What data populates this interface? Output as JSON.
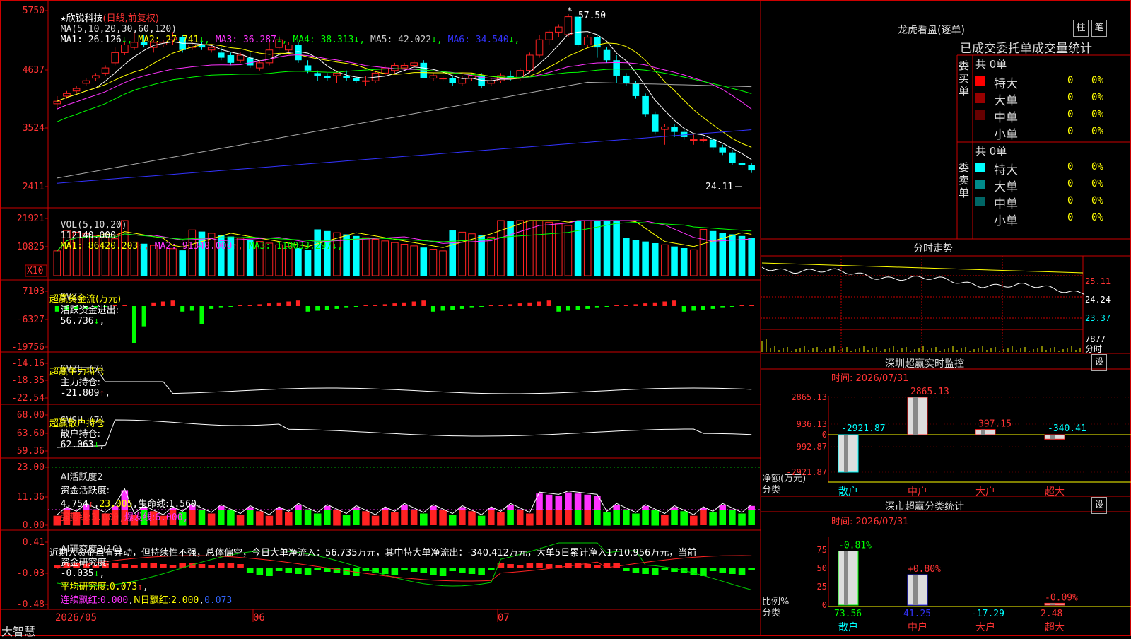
{
  "app": {
    "brand": "大智慧"
  },
  "stock": {
    "star": "★",
    "name": "欣锐科技",
    "mode": "(日线,前复权)"
  },
  "colors": {
    "up": "#ff2222",
    "down": "#00ffff",
    "ma1": "#ffffff",
    "ma2": "#ffff00",
    "ma3": "#ff33ff",
    "ma4": "#00ff00",
    "ma5": "#aaaaaa",
    "ma6": "#3333ff",
    "grid": "#8b0000",
    "frame": "#cc0000"
  },
  "price_panel": {
    "ma_label": "MA(5,10,20,30,60,120)",
    "ma": [
      {
        "name": "MA1:",
        "value": "26.126",
        "arrow": "↓",
        "color": "#ffffff"
      },
      {
        "name": "MA2:",
        "value": "27.741",
        "arrow": "↓",
        "color": "#ffff00"
      },
      {
        "name": "MA3:",
        "value": "36.287",
        "arrow": "↓",
        "color": "#ff33ff"
      },
      {
        "name": "MA4:",
        "value": "38.313",
        "arrow": "↓",
        "color": "#00ff00"
      },
      {
        "name": "MA5:",
        "value": "42.022",
        "arrow": "↓",
        "color": "#cccccc"
      },
      {
        "name": "MA6:",
        "value": "34.540",
        "arrow": "↓",
        "color": "#3333ff"
      }
    ],
    "yticks": [
      "5750",
      "4637",
      "3524",
      "2411"
    ],
    "high_label": "57.50",
    "low_label": "24.11"
  },
  "vol_panel": {
    "label": "VOL(5,10,20)",
    "value": "112140.000",
    "arrow": "↑",
    "items": [
      {
        "name": "MA1:",
        "value": "86420.203",
        "arrow": "↑",
        "color": "#ffff00"
      },
      {
        "name": "MA2:",
        "value": "91340.000",
        "arrow": "↑",
        "color": "#ff33ff"
      },
      {
        "name": "MA3:",
        "value": "110033.297",
        "arrow": "↓",
        "color": "#00ff00"
      }
    ],
    "yticks": [
      "21921",
      "10825"
    ],
    "unit": "X10"
  },
  "svzj_panel": {
    "label": "SVZJ",
    "name": "活跃资金进出:",
    "value": "56.736",
    "arrow": "↓",
    "sub": "超赢资金流(万元)",
    "yticks": [
      "7103",
      "-6327",
      "-19756"
    ]
  },
  "svzl_panel": {
    "label": "SVZL (7)",
    "name": "主力持仓:",
    "value": "-21.809",
    "arrow": "↑",
    "sub": "超赢主力持仓",
    "yticks": [
      "-14.16",
      "-18.35",
      "-22.54"
    ]
  },
  "svsh_panel": {
    "label": "SVSH (7)",
    "name": "散户持仓:",
    "value": "62.063",
    "arrow": "↓",
    "sub": "超赢散户持仓",
    "yticks": [
      "68.00",
      "63.60",
      "59.36"
    ]
  },
  "ai1_panel": {
    "label": "AI活跃度2",
    "name": "资金活跃度:",
    "value": "4.754",
    "arrow": "↑",
    "v2": "23.005",
    "life_name": "生命线:",
    "life": "1.560",
    "strong_name": "强势线:",
    "strong": "3.000",
    "burst_name": "爆发线:",
    "burst": "6.000",
    "yticks": [
      "23.00",
      "11.36",
      "0.00"
    ]
  },
  "ai2_panel": {
    "label": "AI研究度2(10)",
    "name": "资金研究度:",
    "value": "-0.035",
    "arrow": "↓",
    "avg_name": "平均研究度:",
    "avg": "0.073",
    "avg_arrow": "↑",
    "red_name": "连续飘红:",
    "red": "0.000",
    "nred_name": "N日飘红:",
    "nred": "2.000",
    "last": "0.073",
    "yticks": [
      "0.41",
      "-0.03",
      "-0.48"
    ],
    "comment": "近期大资金虽有异动，但持续性不强，总体偏空，今日大单净流入：56.735万元，其中特大单净流出：-340.412万元，大单5日累计净入1710.956万元，当前"
  },
  "date_axis": {
    "labels": [
      "2026/05",
      "06",
      "07"
    ]
  },
  "dragon": {
    "title": "龙虎看盘(逐单)",
    "btn1": "柱",
    "btn2": "笔",
    "header": "已成交委托单成交量统计",
    "buy": {
      "label": "委买单",
      "total": "共 0单",
      "rows": [
        {
          "name": "特大",
          "count": "0",
          "pct": "0%",
          "color": "#ff0000"
        },
        {
          "name": "大单",
          "count": "0",
          "pct": "0%",
          "color": "#990000"
        },
        {
          "name": "中单",
          "count": "0",
          "pct": "0%",
          "color": "#660000"
        },
        {
          "name": "小单",
          "count": "0",
          "pct": "0%",
          "color": ""
        }
      ]
    },
    "sell": {
      "label": "委卖单",
      "total": "共 0单",
      "rows": [
        {
          "name": "特大",
          "count": "0",
          "pct": "0%",
          "color": "#00ffff"
        },
        {
          "name": "大单",
          "count": "0",
          "pct": "0%",
          "color": "#008b8b"
        },
        {
          "name": "中单",
          "count": "0",
          "pct": "0%",
          "color": "#006666"
        },
        {
          "name": "小单",
          "count": "0",
          "pct": "0%",
          "color": ""
        }
      ]
    }
  },
  "intraday": {
    "title": "分时走势",
    "yticks": [
      "25.11",
      "24.24",
      "23.37",
      "7877"
    ],
    "unit": "分时"
  },
  "sz_monitor": {
    "title": "深圳超赢实时监控",
    "btn": "设",
    "time": "时间: 2026/07/31",
    "yticks": [
      "2865.13",
      "936.13",
      "0",
      "-992.87",
      "-2921.87"
    ],
    "ylabel1": "净额(万元)",
    "ylabel2": "分类",
    "categories": [
      "散户",
      "中户",
      "大户",
      "超大"
    ],
    "values": [
      "-2921.87",
      "2865.13",
      "397.15",
      "-340.41"
    ]
  },
  "sz_class": {
    "title": "深市超赢分类统计",
    "btn": "设",
    "time": "时间: 2026/07/31",
    "yticks": [
      "75",
      "50",
      "25",
      "0"
    ],
    "ylabel1": "比例%",
    "ylabel2": "分类",
    "categories": [
      "散户",
      "中户",
      "大户",
      "超大"
    ],
    "pcts": [
      "-0.81%",
      "+0.80%",
      "",
      "-0.09%"
    ],
    "values": [
      "73.56",
      "41.25",
      "-17.29",
      "2.48"
    ]
  },
  "chart_data": [
    {
      "type": "candlestick",
      "title": "欣锐科技 (日线,前复权)",
      "dates": [
        "2026/05",
        "06",
        "07"
      ],
      "ylim": [
        24.11,
        57.5
      ],
      "ohlc": [
        [
          40.0,
          41.5,
          39.0,
          40.5
        ],
        [
          41.5,
          42.5,
          41.0,
          42.0
        ],
        [
          42.5,
          43.5,
          42.0,
          43.0
        ],
        [
          44.0,
          45.0,
          43.5,
          44.5
        ],
        [
          45.0,
          46.0,
          44.5,
          45.5
        ],
        [
          46.0,
          47.5,
          45.5,
          47.0
        ],
        [
          48.0,
          51.0,
          47.5,
          50.0
        ],
        [
          50.0,
          52.0,
          49.5,
          51.5
        ],
        [
          51.0,
          54.0,
          50.5,
          52.0
        ],
        [
          52.0,
          53.5,
          51.0,
          51.5
        ],
        [
          51.0,
          52.5,
          50.0,
          52.0
        ],
        [
          51.5,
          52.5,
          51.0,
          52.0
        ],
        [
          52.5,
          54.0,
          51.5,
          53.0
        ],
        [
          53.0,
          53.5,
          50.0,
          50.5
        ],
        [
          51.0,
          52.0,
          50.5,
          51.5
        ],
        [
          51.5,
          52.0,
          50.5,
          51.0
        ],
        [
          50.5,
          51.5,
          50.0,
          51.0
        ],
        [
          50.0,
          51.0,
          48.5,
          49.0
        ],
        [
          49.5,
          50.0,
          47.5,
          48.0
        ],
        [
          48.5,
          50.0,
          48.0,
          49.5
        ],
        [
          49.0,
          50.0,
          47.0,
          47.5
        ],
        [
          47.0,
          48.5,
          46.5,
          48.0
        ],
        [
          48.0,
          52.0,
          47.5,
          50.5
        ],
        [
          51.0,
          53.5,
          50.5,
          52.5
        ],
        [
          50.5,
          52.0,
          50.0,
          51.5
        ],
        [
          51.5,
          52.0,
          48.0,
          48.5
        ],
        [
          47.5,
          48.5,
          46.0,
          46.5
        ],
        [
          46.0,
          46.5,
          44.5,
          45.5
        ],
        [
          45.5,
          46.0,
          44.5,
          45.0
        ],
        [
          45.5,
          46.5,
          44.0,
          46.0
        ],
        [
          45.5,
          46.5,
          44.5,
          45.0
        ],
        [
          45.0,
          45.5,
          44.0,
          44.5
        ],
        [
          44.5,
          45.5,
          43.5,
          44.5
        ],
        [
          44.5,
          46.5,
          44.0,
          46.0
        ],
        [
          46.0,
          47.5,
          45.5,
          47.0
        ],
        [
          46.5,
          48.0,
          46.0,
          47.5
        ],
        [
          47.0,
          48.0,
          46.5,
          47.5
        ],
        [
          47.5,
          48.5,
          47.0,
          48.0
        ],
        [
          48.0,
          48.5,
          45.5,
          45.0
        ],
        [
          45.0,
          46.0,
          44.5,
          45.5
        ],
        [
          45.0,
          45.5,
          44.5,
          45.0
        ],
        [
          45.0,
          45.5,
          43.5,
          44.0
        ],
        [
          44.0,
          45.5,
          43.5,
          45.0
        ],
        [
          45.0,
          46.0,
          44.5,
          45.5
        ],
        [
          45.5,
          46.0,
          43.0,
          43.5
        ],
        [
          44.0,
          45.0,
          43.5,
          44.5
        ],
        [
          44.5,
          46.0,
          44.0,
          45.5
        ],
        [
          45.5,
          46.5,
          44.5,
          45.0
        ],
        [
          45.0,
          47.0,
          44.5,
          46.5
        ],
        [
          46.5,
          50.0,
          46.0,
          49.5
        ],
        [
          49.5,
          53.5,
          49.0,
          52.5
        ],
        [
          52.5,
          54.5,
          51.5,
          54.0
        ],
        [
          54.0,
          55.5,
          53.0,
          55.0
        ],
        [
          53.5,
          57.5,
          53.0,
          57.0
        ],
        [
          57.0,
          57.0,
          51.0,
          51.5
        ],
        [
          51.5,
          53.5,
          51.0,
          53.0
        ],
        [
          53.0,
          53.5,
          49.0,
          51.0
        ],
        [
          50.5,
          51.0,
          48.0,
          48.5
        ],
        [
          48.5,
          49.5,
          44.0,
          45.5
        ],
        [
          45.5,
          46.0,
          43.5,
          44.0
        ],
        [
          44.0,
          44.5,
          41.0,
          41.5
        ],
        [
          41.5,
          42.0,
          37.5,
          38.0
        ],
        [
          38.0,
          38.5,
          34.0,
          34.5
        ],
        [
          35.0,
          36.0,
          32.0,
          35.5
        ],
        [
          35.5,
          36.0,
          33.5,
          34.5
        ],
        [
          34.5,
          35.0,
          33.0,
          33.5
        ],
        [
          33.0,
          34.0,
          32.0,
          33.0
        ],
        [
          33.0,
          33.5,
          32.5,
          33.0
        ],
        [
          33.0,
          33.5,
          31.0,
          31.5
        ],
        [
          31.5,
          32.0,
          30.0,
          30.5
        ],
        [
          30.5,
          31.0,
          28.0,
          28.5
        ],
        [
          28.5,
          29.0,
          27.5,
          28.0
        ],
        [
          28.0,
          28.5,
          26.5,
          27.0
        ]
      ]
    },
    {
      "type": "bar",
      "title": "VOL(5,10,20)",
      "ylim": [
        0,
        21921
      ]
    },
    {
      "type": "bar",
      "title": "SVZJ 活跃资金进出",
      "ylim": [
        -19756,
        7103
      ]
    },
    {
      "type": "line",
      "title": "SVZL (7) 主力持仓",
      "ylim": [
        -22.54,
        -14.16
      ]
    },
    {
      "type": "line",
      "title": "SVSH (7) 散户持仓",
      "ylim": [
        59.36,
        68.0
      ]
    },
    {
      "type": "bar",
      "title": "AI活跃度2",
      "ylim": [
        0,
        23.0
      ]
    },
    {
      "type": "bar",
      "title": "AI研究度2(10)",
      "ylim": [
        -0.48,
        0.41
      ]
    },
    {
      "type": "bar",
      "title": "深圳超赢实时监控",
      "categories": [
        "散户",
        "中户",
        "大户",
        "超大"
      ],
      "values": [
        -2921.87,
        2865.13,
        397.15,
        -340.41
      ],
      "ylim": [
        -2921.87,
        2865.13
      ]
    },
    {
      "type": "bar",
      "title": "深市超赢分类统计",
      "categories": [
        "散户",
        "中户",
        "大户",
        "超大"
      ],
      "values": [
        73.56,
        41.25,
        -17.29,
        2.48
      ],
      "ylim": [
        0,
        75
      ]
    }
  ]
}
